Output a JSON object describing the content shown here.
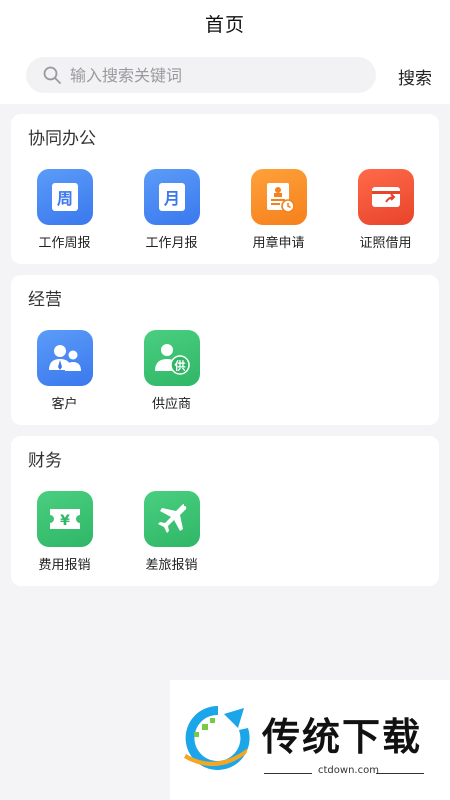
{
  "header": {
    "title": "首页"
  },
  "search": {
    "placeholder": "输入搜索关键词",
    "value": "",
    "button_label": "搜索"
  },
  "sections": [
    {
      "title": "协同办公",
      "items": [
        {
          "label": "工作周报",
          "glyph": "周",
          "color": "#4a8af4",
          "icon": "weekly-report-icon"
        },
        {
          "label": "工作月报",
          "glyph": "月",
          "color": "#4a8af4",
          "icon": "monthly-report-icon"
        },
        {
          "label": "用章申请",
          "color": "#f7902a",
          "icon": "seal-application-icon"
        },
        {
          "label": "证照借用",
          "color": "#f0532f",
          "icon": "license-borrow-icon"
        }
      ]
    },
    {
      "title": "经营",
      "items": [
        {
          "label": "客户",
          "color": "#4a8af4",
          "icon": "customer-icon"
        },
        {
          "label": "供应商",
          "glyph": "供",
          "color": "#3cc272",
          "icon": "supplier-icon"
        }
      ]
    },
    {
      "title": "财务",
      "items": [
        {
          "label": "费用报销",
          "glyph": "¥",
          "color": "#3cc272",
          "icon": "expense-reimbursement-icon"
        },
        {
          "label": "差旅报销",
          "color": "#3cc272",
          "icon": "travel-reimbursement-icon"
        }
      ]
    }
  ],
  "watermark": {
    "brand": "传统下载",
    "site": "ctdown.com"
  }
}
